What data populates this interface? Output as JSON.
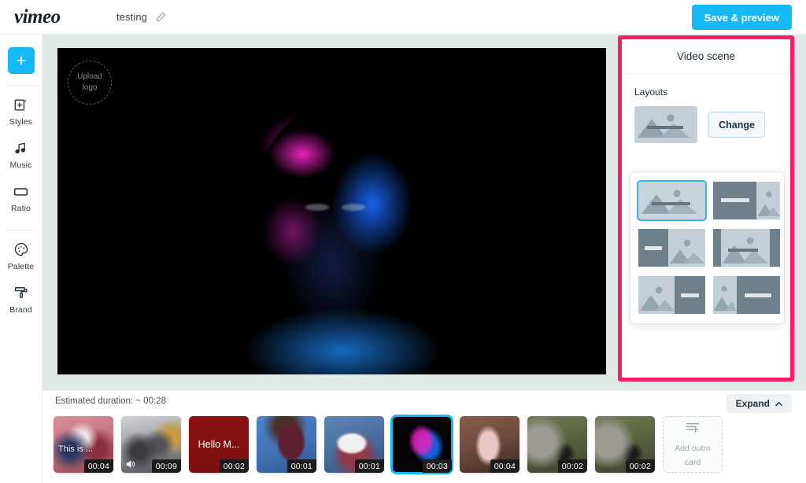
{
  "topbar": {
    "logo_text": "vimeo",
    "project_title": "testing",
    "edit_icon": "pencil-icon",
    "save_label": "Save & preview"
  },
  "sidebar": {
    "add_label": "+",
    "items": [
      {
        "label": "Styles",
        "icon": "styles-icon"
      },
      {
        "label": "Music",
        "icon": "music-icon"
      },
      {
        "label": "Ratio",
        "icon": "ratio-icon"
      },
      {
        "label": "Palette",
        "icon": "palette-icon"
      },
      {
        "label": "Brand",
        "icon": "brand-icon"
      }
    ]
  },
  "canvas": {
    "logo_upload_line1": "Upload",
    "logo_upload_line2": "logo"
  },
  "panel": {
    "title": "Video scene",
    "layouts_label": "Layouts",
    "change_label": "Change",
    "highlight_color": "#fc1b67",
    "accent_color": "#14b9f5",
    "selected_layout_index": 0,
    "layout_options": [
      {
        "name": "full-image",
        "selected": true
      },
      {
        "name": "text-left-image-right",
        "selected": false
      },
      {
        "name": "text-left-image-right-alt",
        "selected": false
      },
      {
        "name": "image-center-text",
        "selected": false
      },
      {
        "name": "image-left-text-right",
        "selected": false
      },
      {
        "name": "image-left-text-right-wide",
        "selected": false
      }
    ]
  },
  "timeline": {
    "estimated_duration": "Estimated duration: ~ 00:28",
    "expand_label": "Expand",
    "expand_icon": "chevron-up-icon",
    "outro": {
      "icon": "add-card-icon",
      "line1": "Add outro",
      "line2": "card"
    },
    "clips": [
      {
        "duration": "00:04",
        "overlay_text": "This is ...",
        "muted": false,
        "selected": false,
        "kind": "photo",
        "style": "ph1"
      },
      {
        "duration": "00:09",
        "overlay_text": "",
        "muted": true,
        "selected": false,
        "kind": "photo",
        "style": "ph2"
      },
      {
        "duration": "00:02",
        "overlay_text": "Hello M...",
        "muted": false,
        "selected": false,
        "kind": "card",
        "style": "ph3"
      },
      {
        "duration": "00:01",
        "overlay_text": "",
        "muted": false,
        "selected": false,
        "kind": "photo",
        "style": "ph4"
      },
      {
        "duration": "00:01",
        "overlay_text": "",
        "muted": false,
        "selected": false,
        "kind": "photo",
        "style": "ph5"
      },
      {
        "duration": "00:03",
        "overlay_text": "",
        "muted": false,
        "selected": true,
        "kind": "photo",
        "style": "ph6"
      },
      {
        "duration": "00:04",
        "overlay_text": "",
        "muted": false,
        "selected": false,
        "kind": "photo",
        "style": "ph7"
      },
      {
        "duration": "00:02",
        "overlay_text": "",
        "muted": false,
        "selected": false,
        "kind": "photo",
        "style": "ph8"
      },
      {
        "duration": "00:02",
        "overlay_text": "",
        "muted": false,
        "selected": false,
        "kind": "photo",
        "style": "ph9"
      }
    ]
  }
}
